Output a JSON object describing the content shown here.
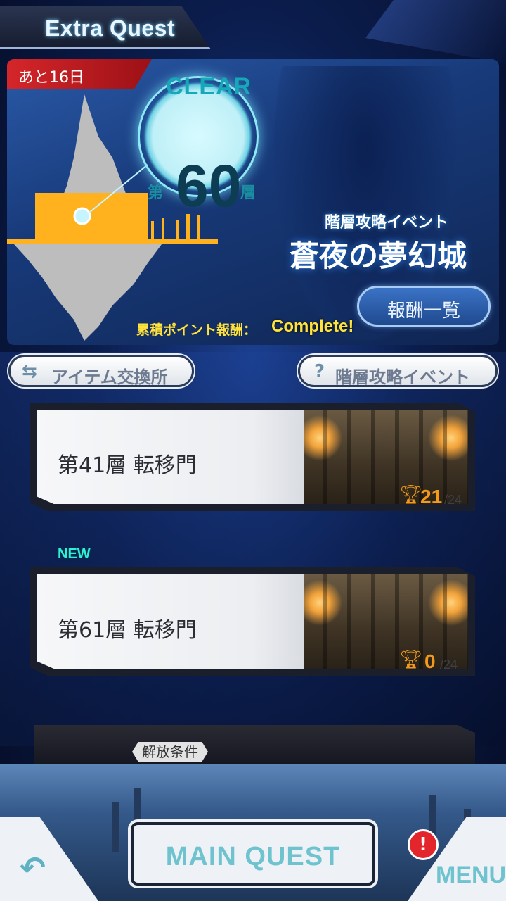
{
  "header": {
    "title": "Extra Quest"
  },
  "banner": {
    "days_remaining": "あと16日",
    "clear_label": "CLEAR",
    "floor_prefix": "第",
    "floor_number": "60",
    "floor_suffix": "層",
    "event_subtitle": "階層攻略イベント",
    "event_title": "蒼夜の夢幻城",
    "reward_list_button": "報酬一覧",
    "points_label": "累積ポイント報酬：",
    "points_value": "Complete!"
  },
  "buttons": {
    "item_exchange": "アイテム交換所",
    "event_help": "階層攻略イベント"
  },
  "quests": [
    {
      "name": "第41層 転移門",
      "progress": "21",
      "total": "/24",
      "is_new": false
    },
    {
      "name": "第61層 転移門",
      "progress": "0",
      "total": "/24",
      "is_new": true,
      "badge": "NEW"
    }
  ],
  "locked": {
    "label": "解放条件"
  },
  "footer": {
    "main_quest": "MAIN QUEST",
    "menu": "MENU",
    "alert": "!"
  },
  "colors": {
    "accent_cyan": "#6fc3cf",
    "trophy": "#f29a1a",
    "days_badge": "#d5262a",
    "points": "#ffe23a"
  }
}
